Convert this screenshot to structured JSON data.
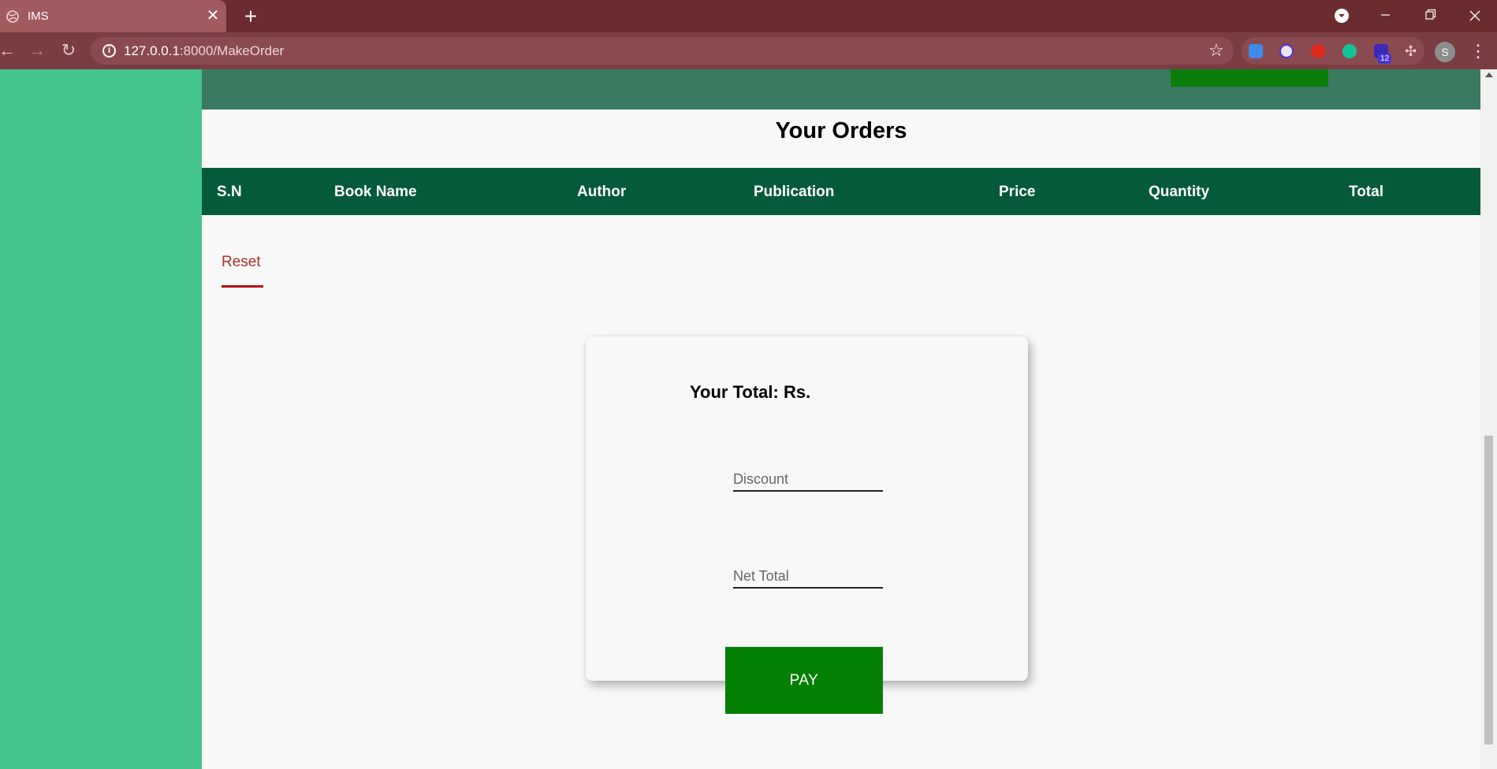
{
  "browser": {
    "tab_title": "IMS",
    "url_host": "127.0.0.1",
    "url_path": ":8000/MakeOrder",
    "extension_badge": "12",
    "profile_initial": "S"
  },
  "page": {
    "orders_title": "Your Orders",
    "table_headers": [
      "S.N",
      "Book Name",
      "Author",
      "Publication",
      "Price",
      "Quantity",
      "Total"
    ],
    "reset_label": "Reset",
    "total_label": "Your Total: Rs.",
    "discount_placeholder": "Discount",
    "net_total_placeholder": "Net Total",
    "pay_label": "PAY"
  },
  "colors": {
    "sidebar": "#44c58b",
    "table_header": "#055a39",
    "pay_button": "#038003",
    "reset": "#b00e0e"
  }
}
